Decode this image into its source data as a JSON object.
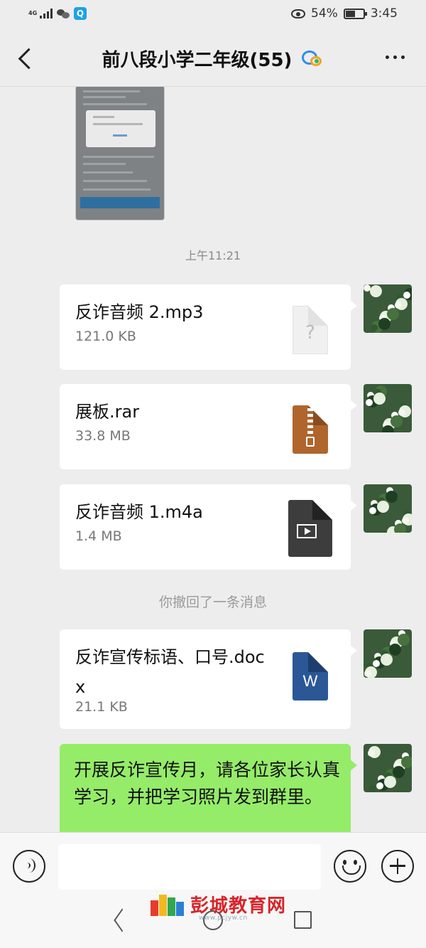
{
  "status_bar": {
    "network": "4G",
    "battery": "54%",
    "battery_level": 0.54,
    "time": "3:45",
    "icons": [
      "signal-icon",
      "wechat-icon",
      "search-app-icon",
      "eye-icon",
      "battery-icon"
    ]
  },
  "header": {
    "title": "前八段小学二年级(55)",
    "icons": [
      "back-icon",
      "enterprise-group-icon",
      "more-icon"
    ]
  },
  "chat": {
    "timestamp": "上午11:21",
    "recall_notice": "你撤回了一条消息",
    "messages": [
      {
        "type": "file",
        "name": "反诈音频 2.mp3",
        "size": "121.0 KB",
        "icon": "unknown-file-icon"
      },
      {
        "type": "file",
        "name": "展板.rar",
        "size": "33.8 MB",
        "icon": "rar-file-icon"
      },
      {
        "type": "file",
        "name": "反诈音频 1.m4a",
        "size": "1.4 MB",
        "icon": "video-file-icon"
      },
      {
        "type": "file",
        "name": "反诈宣传标语、口号.docx",
        "size": "21.1 KB",
        "icon": "word-file-icon",
        "icon_text": "W"
      },
      {
        "type": "text",
        "text": "开展反诈宣传月，请各位家长认真学习，并把学习照片发到群里。"
      }
    ]
  },
  "input_bar": {
    "value": "",
    "placeholder": ""
  },
  "watermark": {
    "text": "彭城教育网",
    "url": "www.pcjyw.cn"
  },
  "colors": {
    "background": "#ededed",
    "sent_bubble": "#95ec69",
    "file_bubble": "#ffffff",
    "watermark": "#d8242a"
  }
}
